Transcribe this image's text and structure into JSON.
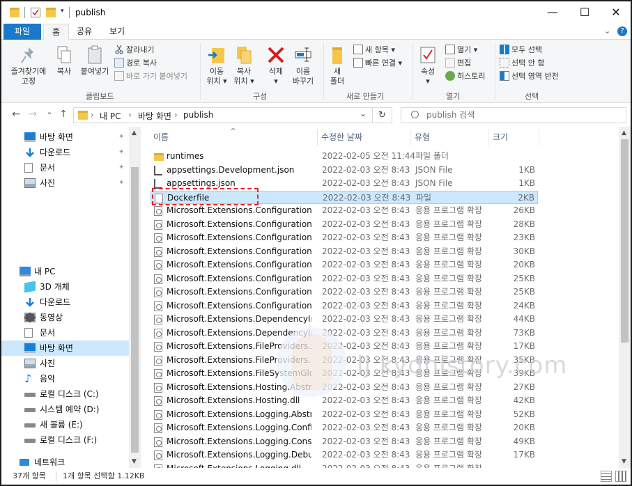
{
  "title": {
    "text": "publish",
    "controls": {
      "minimize": "—",
      "maximize": "☐",
      "close": "✕"
    }
  },
  "tabs": [
    {
      "label": "파일"
    },
    {
      "label": "홈"
    },
    {
      "label": "공유"
    },
    {
      "label": "보기"
    }
  ],
  "ribbon": {
    "clipboard": {
      "pin_label1": "즐겨찾기에",
      "pin_label2": "고정",
      "copy": "복사",
      "paste": "붙여넣기",
      "cut": "잘라내기",
      "copy_path": "경로 복사",
      "paste_shortcut": "바로 가기 붙여넣기",
      "group": "클립보드"
    },
    "organize": {
      "move1": "이동",
      "move2": "위치 ▾",
      "copyto1": "복사",
      "copyto2": "위치 ▾",
      "delete": "삭제",
      "delete2": "▾",
      "rename1": "이름",
      "rename2": "바꾸기",
      "group": "구성"
    },
    "new": {
      "newfolder1": "새",
      "newfolder2": "폴더",
      "newitem": "새 항목 ▾",
      "easyaccess": "빠른 연결 ▾",
      "group": "새로 만들기"
    },
    "open": {
      "properties": "속성",
      "properties2": "▾",
      "open": "열기 ▾",
      "edit": "편집",
      "history": "히스토리",
      "group": "열기"
    },
    "select": {
      "all": "모두 선택",
      "none": "선택 안 함",
      "invert": "선택 영역 반전",
      "group": "선택"
    }
  },
  "address": {
    "back": "←",
    "forward": "→",
    "recent": "⌄",
    "up": "↑",
    "crumbs": [
      "내 PC",
      "바탕 화면",
      "publish"
    ],
    "sep": "›",
    "dropdown": "⌄",
    "refresh": "↻",
    "search_placeholder": "publish 검색"
  },
  "nav": {
    "quick": [
      {
        "label": "바탕 화면",
        "icon": "desktop-icon"
      },
      {
        "label": "다운로드",
        "icon": "download-icon"
      },
      {
        "label": "문서",
        "icon": "document-icon"
      },
      {
        "label": "사진",
        "icon": "picture-icon"
      }
    ],
    "thispc": {
      "label": "내 PC"
    },
    "pc_items": [
      {
        "label": "3D 개체",
        "icon": "3d-objects-icon"
      },
      {
        "label": "다운로드",
        "icon": "download-icon"
      },
      {
        "label": "동영상",
        "icon": "video-icon"
      },
      {
        "label": "문서",
        "icon": "document-icon"
      },
      {
        "label": "바탕 화면",
        "icon": "desktop-icon",
        "selected": true
      },
      {
        "label": "사진",
        "icon": "picture-icon"
      },
      {
        "label": "음악",
        "icon": "music-icon"
      },
      {
        "label": "로컬 디스크 (C:)",
        "icon": "drive-icon"
      },
      {
        "label": "시스템 예약 (D:)",
        "icon": "drive-icon"
      },
      {
        "label": "새 볼륨 (E:)",
        "icon": "drive-icon"
      },
      {
        "label": "로컬 디스크 (F:)",
        "icon": "drive-icon"
      }
    ],
    "network": {
      "label": "네트워크"
    },
    "pin_glyph": "📌"
  },
  "columns": {
    "name": "이름",
    "date": "수정한 날짜",
    "type": "유형",
    "size": "크기",
    "sort_glyph": "^"
  },
  "files": [
    {
      "name": "runtimes",
      "date": "2022-02-05 오전 11:44",
      "type": "파일 폴더",
      "size": "",
      "kind": "folder"
    },
    {
      "name": "appsettings.Development.json",
      "date": "2022-02-03 오전 8:43",
      "type": "JSON File",
      "size": "1KB",
      "kind": "json"
    },
    {
      "name": "appsettings.json",
      "date": "2022-02-03 오전 8:43",
      "type": "JSON File",
      "size": "1KB",
      "kind": "json"
    },
    {
      "name": "Dockerfile",
      "date": "2022-02-03 오전 8:43",
      "type": "파일",
      "size": "2KB",
      "kind": "file",
      "selected": true
    },
    {
      "name": "Microsoft.Extensions.Configuration.Abst...",
      "date": "2022-02-03 오전 8:43",
      "type": "응용 프로그램 확장",
      "size": "26KB",
      "kind": "dll"
    },
    {
      "name": "Microsoft.Extensions.Configuration.Bind...",
      "date": "2022-02-03 오전 8:43",
      "type": "응용 프로그램 확장",
      "size": "28KB",
      "kind": "dll"
    },
    {
      "name": "Microsoft.Extensions.Configuration.Com...",
      "date": "2022-02-03 오전 8:43",
      "type": "응용 프로그램 확장",
      "size": "23KB",
      "kind": "dll"
    },
    {
      "name": "Microsoft.Extensions.Configuration.dll",
      "date": "2022-02-03 오전 8:43",
      "type": "응용 프로그램 확장",
      "size": "30KB",
      "kind": "dll"
    },
    {
      "name": "Microsoft.Extensions.Configuration.Envir...",
      "date": "2022-02-03 오전 8:43",
      "type": "응용 프로그램 확장",
      "size": "20KB",
      "kind": "dll"
    },
    {
      "name": "Microsoft.Extensions.Configuration.FileE...",
      "date": "2022-02-03 오전 8:43",
      "type": "응용 프로그램 확장",
      "size": "25KB",
      "kind": "dll"
    },
    {
      "name": "Microsoft.Extensions.Configuration.Json....",
      "date": "2022-02-03 오전 8:43",
      "type": "응용 프로그램 확장",
      "size": "25KB",
      "kind": "dll"
    },
    {
      "name": "Microsoft.Extensions.Configuration.User...",
      "date": "2022-02-03 오전 8:43",
      "type": "응용 프로그램 확장",
      "size": "24KB",
      "kind": "dll"
    },
    {
      "name": "Microsoft.Extensions.DependencyInjecti...",
      "date": "2022-02-03 오전 8:43",
      "type": "응용 프로그램 확장",
      "size": "44KB",
      "kind": "dll"
    },
    {
      "name": "Microsoft.Extensions.DependencyInjecti...",
      "date": "2022-02-03 오전 8:43",
      "type": "응용 프로그램 확장",
      "size": "73KB",
      "kind": "dll"
    },
    {
      "name": "Microsoft.Extensions.FileProviders.Abstra...",
      "date": "2022-02-03 오전 8:43",
      "type": "응용 프로그램 확장",
      "size": "17KB",
      "kind": "dll"
    },
    {
      "name": "Microsoft.Extensions.FileProviders.Physic...",
      "date": "2022-02-03 오전 8:43",
      "type": "응용 프로그램 확장",
      "size": "35KB",
      "kind": "dll"
    },
    {
      "name": "Microsoft.Extensions.FileSystemGlobbin...",
      "date": "2022-02-03 오전 8:43",
      "type": "응용 프로그램 확장",
      "size": "39KB",
      "kind": "dll"
    },
    {
      "name": "Microsoft.Extensions.Hosting.Abstractio...",
      "date": "2022-02-03 오전 8:43",
      "type": "응용 프로그램 확장",
      "size": "27KB",
      "kind": "dll"
    },
    {
      "name": "Microsoft.Extensions.Hosting.dll",
      "date": "2022-02-03 오전 8:43",
      "type": "응용 프로그램 확장",
      "size": "42KB",
      "kind": "dll"
    },
    {
      "name": "Microsoft.Extensions.Logging.Abstractio...",
      "date": "2022-02-03 오전 8:43",
      "type": "응용 프로그램 확장",
      "size": "52KB",
      "kind": "dll"
    },
    {
      "name": "Microsoft.Extensions.Logging.Configurat...",
      "date": "2022-02-03 오전 8:43",
      "type": "응용 프로그램 확장",
      "size": "20KB",
      "kind": "dll"
    },
    {
      "name": "Microsoft.Extensions.Logging.Console.dll",
      "date": "2022-02-03 오전 8:43",
      "type": "응용 프로그램 확장",
      "size": "49KB",
      "kind": "dll"
    },
    {
      "name": "Microsoft.Extensions.Logging.Debug.dll",
      "date": "2022-02-03 오전 8:43",
      "type": "응용 프로그램 확장",
      "size": "17KB",
      "kind": "dll"
    },
    {
      "name": "Microsoft.Extensions.Logging.dll",
      "date": "2022-02-03 오전 8:43",
      "type": "응용 프로그램 확장",
      "size": "",
      "kind": "dll"
    }
  ],
  "watermark": {
    "text": "lj.kydhistory.com"
  },
  "status": {
    "count": "37개 항목",
    "selection": "1개 항목 선택함 1.12KB"
  },
  "colors": {
    "accent": "#1979ca",
    "selection": "#cce8ff",
    "highlight_box": "#e0282d"
  }
}
